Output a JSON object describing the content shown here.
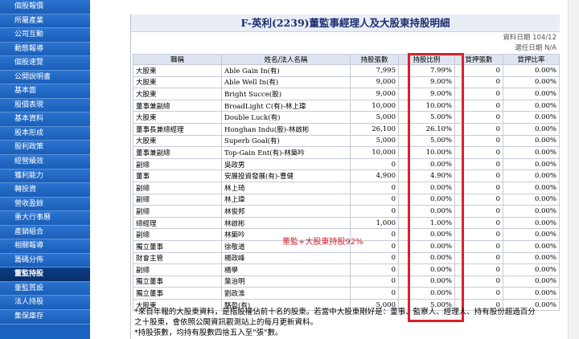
{
  "sidebar": {
    "items": [
      {
        "label": "個股報價",
        "active": false
      },
      {
        "label": "所屬產業",
        "active": false
      },
      {
        "label": "公司互動",
        "active": false
      },
      {
        "label": "動態報導",
        "active": false
      },
      {
        "label": "個股速覽",
        "active": false
      },
      {
        "label": "公開說明書",
        "active": false
      },
      {
        "label": "基本面",
        "active": false
      },
      {
        "label": "股價表現",
        "active": false
      },
      {
        "label": "基本資料",
        "active": false
      },
      {
        "label": "股本形成",
        "active": false
      },
      {
        "label": "股利政策",
        "active": false
      },
      {
        "label": "經營績效",
        "active": false
      },
      {
        "label": "獲利能力",
        "active": false
      },
      {
        "label": "轉投資",
        "active": false
      },
      {
        "label": "營收盈餘",
        "active": false
      },
      {
        "label": "重大行事曆",
        "active": false
      },
      {
        "label": "產銷組合",
        "active": false
      },
      {
        "label": "相關報導",
        "active": false
      },
      {
        "label": "籌碼分佈",
        "active": false
      },
      {
        "label": "董監持股",
        "active": true
      },
      {
        "label": "董監質設",
        "active": false
      },
      {
        "label": "法人持股",
        "active": false
      },
      {
        "label": "集保庫存",
        "active": false
      }
    ]
  },
  "page": {
    "title": "F-英利(2239)董監事經理人及大股東持股明細",
    "data_date": "資料日期 104/12",
    "pledge_date": "選任日期 N/A"
  },
  "table": {
    "headers": [
      "職稱",
      "姓名/法人名稱",
      "持股張數",
      "持股比例",
      "質押張數",
      "質押比率"
    ],
    "rows": [
      [
        "大股東",
        "Able Gain In(有)",
        "7,995",
        "7.99%",
        "0",
        "0.00%"
      ],
      [
        "大股東",
        "Able Well In(有)",
        "9,000",
        "9.00%",
        "0",
        "0.00%"
      ],
      [
        "大股東",
        "Bright Succe(股)",
        "9,000",
        "9.00%",
        "0",
        "0.00%"
      ],
      [
        "董事兼副總",
        "BroadLight C(有)-林上瑋",
        "10,000",
        "10.00%",
        "0",
        "0.00%"
      ],
      [
        "大股東",
        "Double Luck(有)",
        "5,000",
        "5.00%",
        "0",
        "0.00%"
      ],
      [
        "董事長兼總經理",
        "Honghan Indu(股)-林啟彬",
        "26,100",
        "26.10%",
        "0",
        "0.00%"
      ],
      [
        "大股東",
        "Superb Goal(有)",
        "5,000",
        "5.00%",
        "0",
        "0.00%"
      ],
      [
        "董事兼副總",
        "Top-Gain Ent(有)-林築吟",
        "10,000",
        "10.00%",
        "0",
        "0.00%"
      ],
      [
        "副總",
        "吳政男",
        "0",
        "0.00%",
        "0",
        "0.00%"
      ],
      [
        "董事",
        "安展投資發展(有)-曹健",
        "4,900",
        "4.90%",
        "0",
        "0.00%"
      ],
      [
        "副總",
        "林上琦",
        "0",
        "0.00%",
        "0",
        "0.00%"
      ],
      [
        "副總",
        "林上瑋",
        "0",
        "0.00%",
        "0",
        "0.00%"
      ],
      [
        "副總",
        "林俊邦",
        "0",
        "0.00%",
        "0",
        "0.00%"
      ],
      [
        "總經理",
        "林啟彬",
        "1,000",
        "1.00%",
        "0",
        "0.00%"
      ],
      [
        "副總",
        "林築吟",
        "0",
        "0.00%",
        "0",
        "0.00%"
      ],
      [
        "獨立董事",
        "徐敬道",
        "0",
        "0.00%",
        "0",
        "0.00%"
      ],
      [
        "財會主管",
        "楊政峰",
        "0",
        "0.00%",
        "0",
        "0.00%"
      ],
      [
        "副總",
        "楊學",
        "0",
        "0.00%",
        "0",
        "0.00%"
      ],
      [
        "獨立董事",
        "葉治明",
        "0",
        "0.00%",
        "0",
        "0.00%"
      ],
      [
        "獨立董事",
        "劉政淮",
        "0",
        "0.00%",
        "0",
        "0.00%"
      ],
      [
        "大股東",
        "駱盈(有)",
        "5,000",
        "5.00%",
        "0",
        "0.00%"
      ]
    ]
  },
  "annotation": {
    "text": "董監+大股東持股92%",
    "color": "#d9212b"
  },
  "notes": [
    "*來自年報的大股東資料，是指股權佔前十名的股東。若當中大股東剛好是：董事、監察人、經理人、持有股份超過百分",
    "之十股東，會依照公開資訊觀測站上的每月更新資料。",
    "*持股張數，均持有股數四捨五入至\"張\"數。"
  ],
  "colors": {
    "sidebar": "#1b63c0",
    "sidebar_active": "#0a2f6a",
    "highlight": "#d9212b",
    "header_bg": "#dfe5f0"
  }
}
